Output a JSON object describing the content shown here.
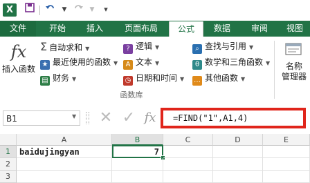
{
  "app": {
    "logo": "X"
  },
  "quick_access": {
    "save_icon": "save-icon",
    "undo_icon": "undo-icon",
    "redo_icon": "redo-icon"
  },
  "tabs": [
    {
      "label": "文件"
    },
    {
      "label": "开始"
    },
    {
      "label": "插入"
    },
    {
      "label": "页面布局"
    },
    {
      "label": "公式"
    },
    {
      "label": "数据"
    },
    {
      "label": "审阅"
    },
    {
      "label": "视图"
    }
  ],
  "ribbon": {
    "insert_function": {
      "icon_glyph": "fx",
      "label": "插入函数"
    },
    "autosum": {
      "glyph": "Σ",
      "label": "自动求和"
    },
    "recent": {
      "label": "最近使用的函数"
    },
    "financial": {
      "label": "财务"
    },
    "logical": {
      "label": "逻辑"
    },
    "text": {
      "label": "文本"
    },
    "datetime": {
      "label": "日期和时间"
    },
    "lookup": {
      "label": "查找与引用"
    },
    "math": {
      "label": "数学和三角函数"
    },
    "other": {
      "label": "其他函数"
    },
    "name_manager": {
      "label_line1": "名称",
      "label_line2": "管理器"
    },
    "group_label": "函数库"
  },
  "formula_bar": {
    "name_box": "B1",
    "cancel": "✕",
    "enter": "✓",
    "formula": "=FIND(\"1\",A1,4)"
  },
  "sheet": {
    "columns": [
      "A",
      "B",
      "C",
      "D",
      "E"
    ],
    "rows": [
      "1",
      "2",
      "3"
    ],
    "cells": {
      "A1": "baidujingyan",
      "B1": "7"
    }
  },
  "colors": {
    "accent": "#217346",
    "highlight": "#e0251b"
  }
}
